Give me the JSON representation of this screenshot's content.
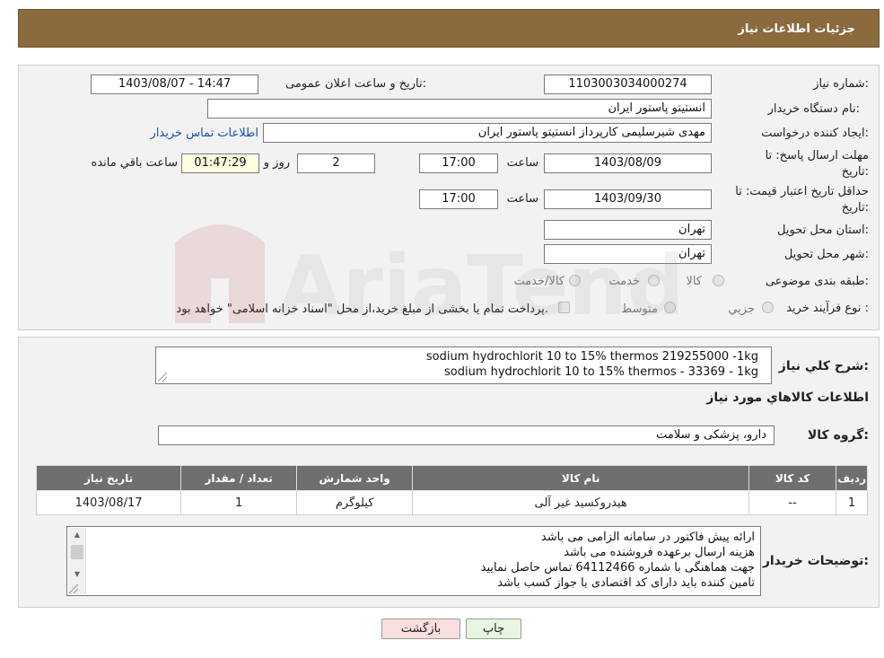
{
  "header": {
    "title": "جزئیات اطلاعات نیاز"
  },
  "form": {
    "need_number_label": "شماره نیاز:",
    "need_number": "1103003034000274",
    "announce_label": "تاریخ و ساعت اعلان عمومی:",
    "announce_value": "1403/08/07 - 14:47",
    "buyer_org_label": "نام دستگاه خریدار:",
    "buyer_org": "انستیتو پاستور ایران",
    "creator_label": "ایجاد کننده درخواست:",
    "creator": "مهدی شیرسلیمی کارپرداز انستیتو پاستور ایران",
    "contact_link": "اطلاعات تماس خریدار",
    "deadline_label_1": "مهلت ارسال پاسخ: تا",
    "deadline_label_2": "تاریخ:",
    "deadline_date": "1403/08/09",
    "time_label": "ساعت",
    "deadline_time": "17:00",
    "days_value": "2",
    "days_label": "روز و",
    "remaining_time": "01:47:29",
    "remaining_label": "ساعت باقي مانده",
    "validity_label_1": "حداقل تاریخ اعتبار قیمت: تا",
    "validity_label_2": "تاریخ:",
    "validity_date": "1403/09/30",
    "validity_time": "17:00",
    "province_label": "استان محل تحویل:",
    "province": "تهران",
    "city_label": "شهر محل تحویل:",
    "city": "تهران",
    "category_label": "طبقه بندی موضوعی:",
    "category_options": [
      "کالا",
      "خدمت",
      "کالا/خدمت"
    ],
    "process_label": "نوع فرآیند خرید :",
    "process_options": [
      "جزیي",
      "متوسط"
    ],
    "process_note": "پرداخت تمام یا بخشی از مبلغ خرید،از محل \"اسناد خزانه اسلامی\" خواهد بود."
  },
  "description": {
    "label": "شرح کلي نياز:",
    "lines": [
      "sodium hydrochlorit 10 to 15% thermos 219255000 -1kg",
      "sodium hydrochlorit 10 to 15% thermos - 33369 - 1kg"
    ]
  },
  "items_section": {
    "title": "اطلاعات کالاهاي مورد نياز",
    "group_label": "گروه کالا:",
    "group_value": "دارو، پزشکی و سلامت",
    "columns": [
      "رديف",
      "کد کالا",
      "نام کالا",
      "واحد شمارش",
      "تعداد / مقدار",
      "تاريخ نياز"
    ],
    "rows": [
      [
        "1",
        "--",
        "هیدروکسید غیر آلی",
        "کیلوگرم",
        "1",
        "1403/08/17"
      ]
    ]
  },
  "buyer_notes": {
    "label": "توضیحات خریدار:",
    "lines": [
      "ارائه پیش فاکتور در سامانه الزامی می باشد",
      "هزینه ارسال برعهده فروشنده می باشد",
      "جهت هماهنگی با شماره 64112466 تماس حاصل نمایید",
      "تامین کننده باید دارای کد اقتصادی یا جواز کسب باشد"
    ]
  },
  "buttons": {
    "print": "چاپ",
    "back": "بازگشت"
  },
  "watermark": {
    "text": "AriaTender.neT"
  },
  "colors": {
    "header_bg": "#8b6a3e",
    "link": "#1a4fb0",
    "table_header": "#6f6f6f",
    "back_button": "#f8dede",
    "print_button": "#e8f5e0"
  }
}
